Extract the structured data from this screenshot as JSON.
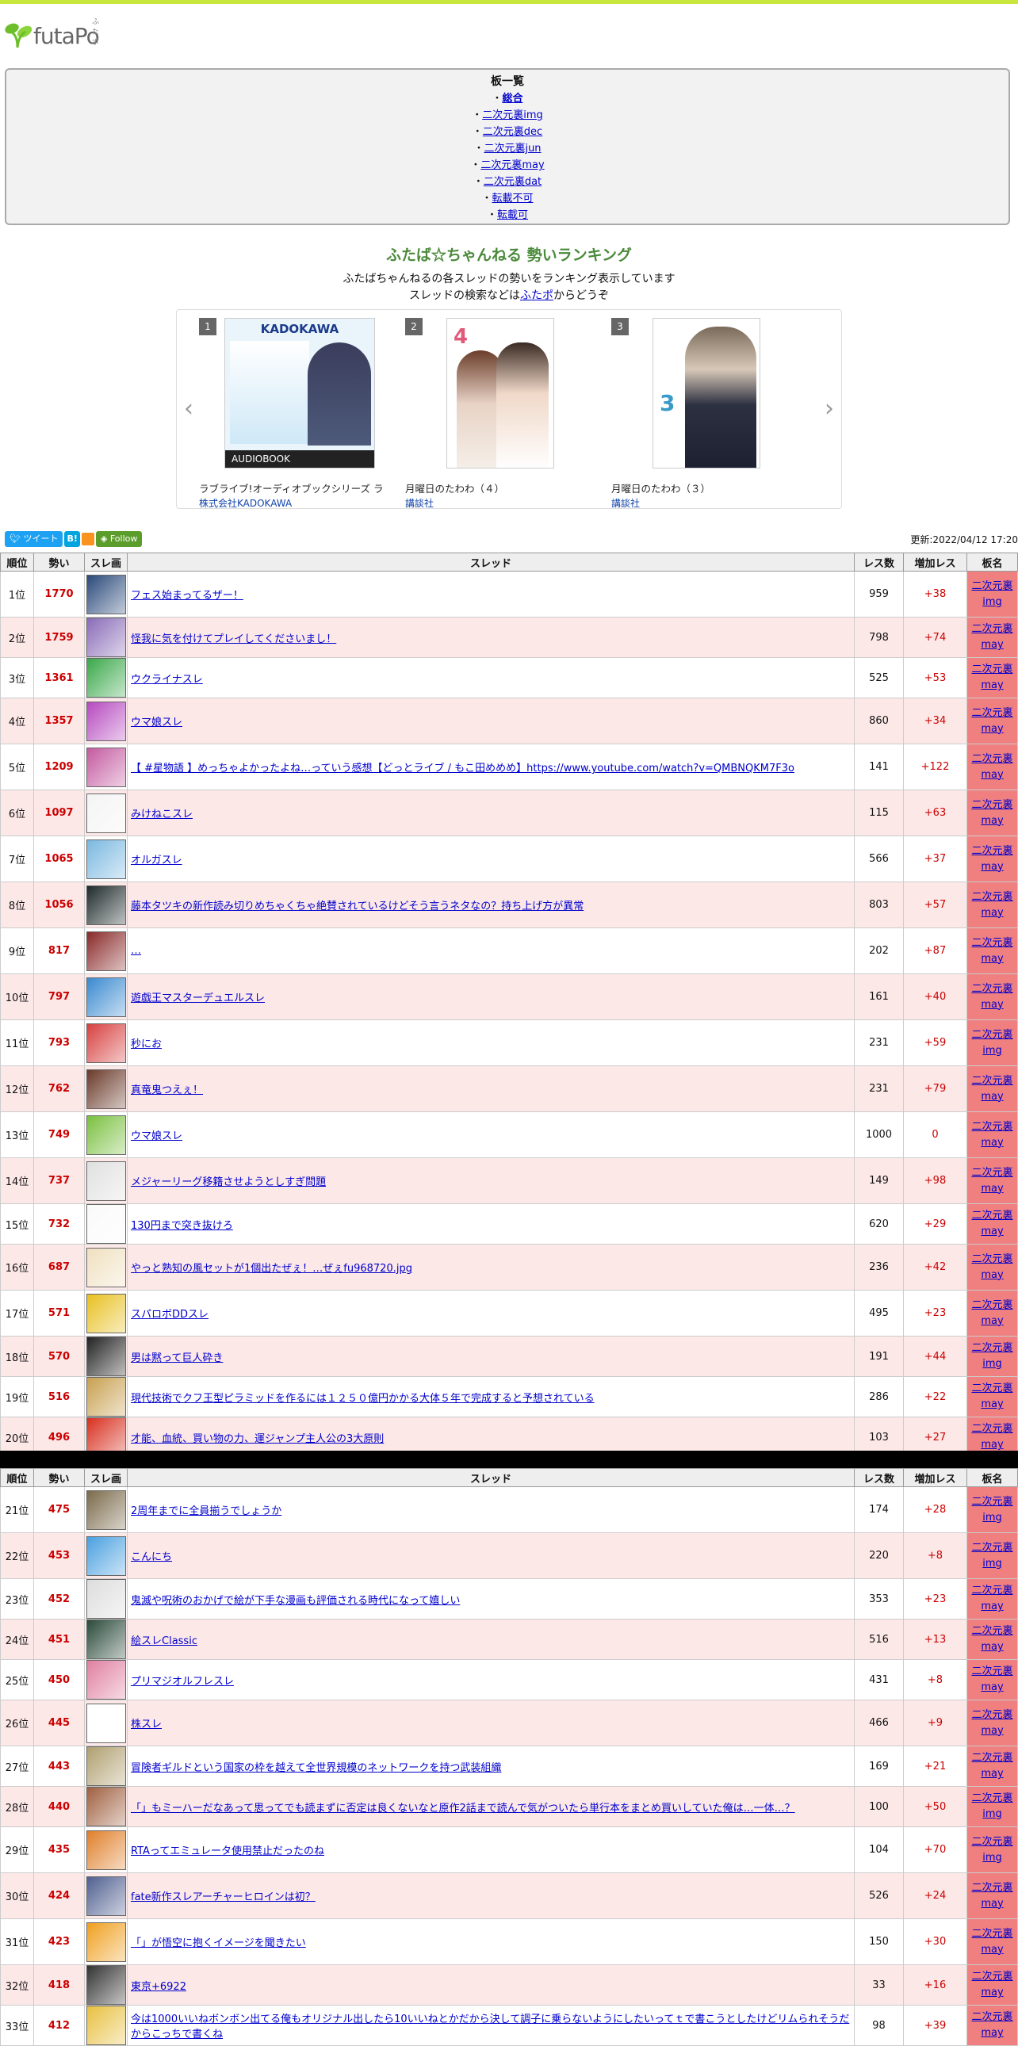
{
  "header": {
    "logo_text": "futaPo",
    "logo_ruby": "ふたポ"
  },
  "boards": {
    "heading": "板一覧",
    "items": [
      "総合",
      "二次元裏img",
      "二次元裏dec",
      "二次元裏jun",
      "二次元裏may",
      "二次元裏dat",
      "転載不可",
      "転載可"
    ]
  },
  "hero": {
    "title": "ふたば☆ちゃんねる 勢いランキング",
    "line1": "ふたばちゃんねるの各スレッドの勢いをランキング表示しています",
    "line2_pre": "スレッドの検索などは",
    "line2_link": "ふたポ",
    "line2_post": "からどうぞ"
  },
  "carousel": [
    {
      "rank": "1",
      "title": "ラブライブ!オーディオブックシリーズ ラ",
      "publisher": "株式会社KADOKAWA",
      "cover_brand": "KADOKAWA",
      "cover_band": "AUDIOBOOK"
    },
    {
      "rank": "2",
      "title": "月曜日のたわわ（４）",
      "publisher": "講談社",
      "cover_brand": "",
      "cover_band": ""
    },
    {
      "rank": "3",
      "title": "月曜日のたわわ（３）",
      "publisher": "講談社",
      "cover_brand": "",
      "cover_band": ""
    }
  ],
  "social": {
    "tweet": "ツイート",
    "hatena": "B!",
    "follow": "Follow"
  },
  "updated": "更新:2022/04/12 17:20",
  "table_headers": {
    "rank": "順位",
    "score": "勢い",
    "thumb": "スレ画",
    "thread": "スレッド",
    "res": "レス数",
    "inc": "増加レス",
    "board": "板名"
  },
  "rows": [
    {
      "rank": "1位",
      "score": "1770",
      "title": "フェス始まってるザー！",
      "res": "959",
      "inc": "+38",
      "board1": "二次元裏",
      "board2": "img"
    },
    {
      "rank": "2位",
      "score": "1759",
      "title": "怪我に気を付けてプレイしてくださいまし！",
      "res": "798",
      "inc": "+74",
      "board1": "二次元裏",
      "board2": "may"
    },
    {
      "rank": "3位",
      "score": "1361",
      "title": "ウクライナスレ",
      "res": "525",
      "inc": "+53",
      "board1": "二次元裏",
      "board2": "may"
    },
    {
      "rank": "4位",
      "score": "1357",
      "title": "ウマ娘スレ",
      "res": "860",
      "inc": "+34",
      "board1": "二次元裏",
      "board2": "may"
    },
    {
      "rank": "5位",
      "score": "1209",
      "title": "【 #星物語 】めっちゃよかったよね…っていう感想【どっとライブ / もこ田めめめ】https://www.youtube.com/watch?v=QMBNQKM7F3o",
      "res": "141",
      "inc": "+122",
      "board1": "二次元裏",
      "board2": "may"
    },
    {
      "rank": "6位",
      "score": "1097",
      "title": "みけねこスレ",
      "res": "115",
      "inc": "+63",
      "board1": "二次元裏",
      "board2": "may"
    },
    {
      "rank": "7位",
      "score": "1065",
      "title": "オルガスレ",
      "res": "566",
      "inc": "+37",
      "board1": "二次元裏",
      "board2": "may"
    },
    {
      "rank": "8位",
      "score": "1056",
      "title": "藤本タツキの新作読み切りめちゃくちゃ絶賛されているけどそう言うネタなの？持ち上げ方が異常",
      "res": "803",
      "inc": "+57",
      "board1": "二次元裏",
      "board2": "may"
    },
    {
      "rank": "9位",
      "score": "817",
      "title": "…",
      "res": "202",
      "inc": "+87",
      "board1": "二次元裏",
      "board2": "may"
    },
    {
      "rank": "10位",
      "score": "797",
      "title": "遊戯王マスターデュエルスレ",
      "res": "161",
      "inc": "+40",
      "board1": "二次元裏",
      "board2": "may"
    },
    {
      "rank": "11位",
      "score": "793",
      "title": "秒にお",
      "res": "231",
      "inc": "+59",
      "board1": "二次元裏",
      "board2": "img"
    },
    {
      "rank": "12位",
      "score": "762",
      "title": "真竜鬼つえぇ！",
      "res": "231",
      "inc": "+79",
      "board1": "二次元裏",
      "board2": "may"
    },
    {
      "rank": "13位",
      "score": "749",
      "title": "ウマ娘スレ",
      "res": "1000",
      "inc": "0",
      "board1": "二次元裏",
      "board2": "may"
    },
    {
      "rank": "14位",
      "score": "737",
      "title": "メジャーリーグ移籍させようとしすぎ問題",
      "res": "149",
      "inc": "+98",
      "board1": "二次元裏",
      "board2": "may"
    },
    {
      "rank": "15位",
      "score": "732",
      "title": "130円まで突き抜けろ",
      "res": "620",
      "inc": "+29",
      "board1": "二次元裏",
      "board2": "may"
    },
    {
      "rank": "16位",
      "score": "687",
      "title": "やっと熟知の風セットが1個出たぜぇ！…ぜぇfu968720.jpg",
      "res": "236",
      "inc": "+42",
      "board1": "二次元裏",
      "board2": "may"
    },
    {
      "rank": "17位",
      "score": "571",
      "title": "スパロボDDスレ",
      "res": "495",
      "inc": "+23",
      "board1": "二次元裏",
      "board2": "may"
    },
    {
      "rank": "18位",
      "score": "570",
      "title": "男は黙って巨人砕き",
      "res": "191",
      "inc": "+44",
      "board1": "二次元裏",
      "board2": "img"
    },
    {
      "rank": "19位",
      "score": "516",
      "title": "現代技術でクフ王型ピラミッドを作るには１２５０億円かかる大体５年で完成すると予想されている",
      "res": "286",
      "inc": "+22",
      "board1": "二次元裏",
      "board2": "may"
    },
    {
      "rank": "20位",
      "score": "496",
      "title": "才能、血統、買い物の力、運ジャンプ主人公の3大原則",
      "res": "103",
      "inc": "+27",
      "board1": "二次元裏",
      "board2": "may"
    }
  ],
  "rows2": [
    {
      "rank": "21位",
      "score": "475",
      "title": "2周年までに全員揃うでしょうか",
      "res": "174",
      "inc": "+28",
      "board1": "二次元裏",
      "board2": "img"
    },
    {
      "rank": "22位",
      "score": "453",
      "title": "こんにち",
      "res": "220",
      "inc": "+8",
      "board1": "二次元裏",
      "board2": "img"
    },
    {
      "rank": "23位",
      "score": "452",
      "title": "鬼滅や呪術のおかげで絵が下手な漫画も評価される時代になって嬉しい",
      "res": "353",
      "inc": "+23",
      "board1": "二次元裏",
      "board2": "may"
    },
    {
      "rank": "24位",
      "score": "451",
      "title": "絵スレClassic",
      "res": "516",
      "inc": "+13",
      "board1": "二次元裏",
      "board2": "may"
    },
    {
      "rank": "25位",
      "score": "450",
      "title": "プリマジオルフレスレ",
      "res": "431",
      "inc": "+8",
      "board1": "二次元裏",
      "board2": "may"
    },
    {
      "rank": "26位",
      "score": "445",
      "title": "株スレ",
      "res": "466",
      "inc": "+9",
      "board1": "二次元裏",
      "board2": "may"
    },
    {
      "rank": "27位",
      "score": "443",
      "title": "冒険者ギルドという国家の枠を越えて全世界規模のネットワークを持つ武装組織",
      "res": "169",
      "inc": "+21",
      "board1": "二次元裏",
      "board2": "may"
    },
    {
      "rank": "28位",
      "score": "440",
      "title": "「」もミーハーだなあって思ってでも読まずに否定は良くないなと原作2話まで読んで気がついたら単行本をまとめ買いしていた俺は…一体…？",
      "res": "100",
      "inc": "+50",
      "board1": "二次元裏",
      "board2": "img"
    },
    {
      "rank": "29位",
      "score": "435",
      "title": "RTAってエミュレータ使用禁止だったのね",
      "res": "104",
      "inc": "+70",
      "board1": "二次元裏",
      "board2": "img"
    },
    {
      "rank": "30位",
      "score": "424",
      "title": "fate新作スレアーチャーヒロインは初？",
      "res": "526",
      "inc": "+24",
      "board1": "二次元裏",
      "board2": "may"
    },
    {
      "rank": "31位",
      "score": "423",
      "title": "「」が悟空に抱くイメージを聞きたい",
      "res": "150",
      "inc": "+30",
      "board1": "二次元裏",
      "board2": "may"
    },
    {
      "rank": "32位",
      "score": "418",
      "title": "東京+6922",
      "res": "33",
      "inc": "+16",
      "board1": "二次元裏",
      "board2": "may"
    },
    {
      "rank": "33位",
      "score": "412",
      "title": "今は1000いいねボンボン出てる俺もオリジナル出したら10いいねとかだから決して調子に乗らないようにしたいってｔで書こうとしたけどリムられそうだからこっちで書くね",
      "res": "98",
      "inc": "+39",
      "board1": "二次元裏",
      "board2": "may"
    }
  ]
}
